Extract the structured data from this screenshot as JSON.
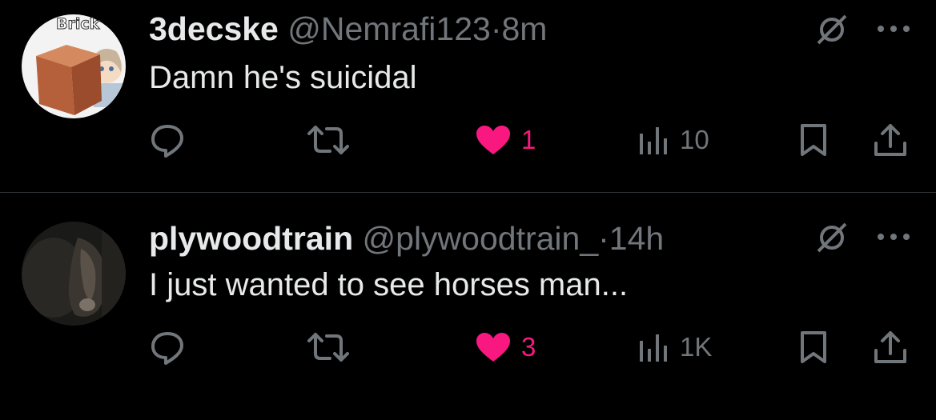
{
  "colors": {
    "background": "#000000",
    "primary_text": "#e7e9ea",
    "secondary_text": "#71767b",
    "like_active": "#f91880",
    "divider": "#2f3336"
  },
  "tweets": [
    {
      "display_name": "3decske",
      "handle": "@Nemrafi123",
      "separator": "·",
      "time": "8m",
      "text": "Damn he's suicidal",
      "avatar_label": "Brick",
      "likes": "1",
      "liked": true,
      "views": "10",
      "icons": [
        "reply-icon",
        "retweet-icon",
        "heart-icon",
        "views-icon",
        "bookmark-icon",
        "share-icon",
        "muted-icon",
        "more-icon"
      ]
    },
    {
      "display_name": "plywoodtrain",
      "handle": "@plywoodtrain_",
      "separator": "·",
      "time": "14h",
      "text": "I just wanted to see horses man...",
      "likes": "3",
      "liked": true,
      "views": "1K",
      "icons": [
        "reply-icon",
        "retweet-icon",
        "heart-icon",
        "views-icon",
        "bookmark-icon",
        "share-icon",
        "muted-icon",
        "more-icon"
      ]
    }
  ]
}
